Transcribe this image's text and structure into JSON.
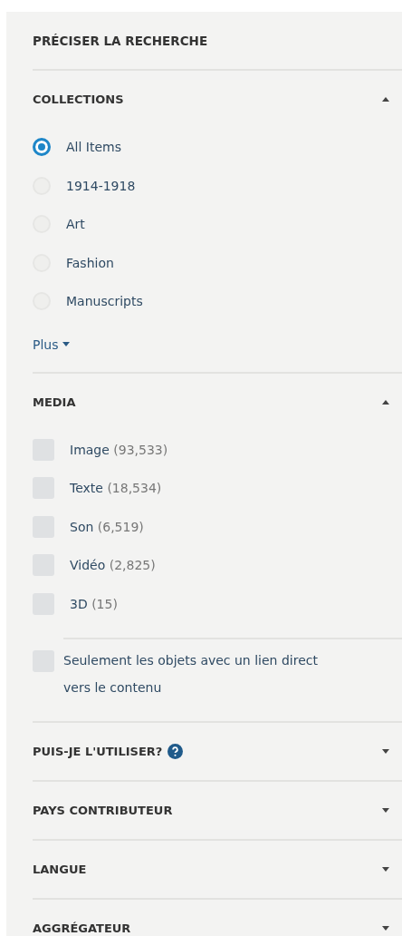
{
  "title": "PRÉCISER LA RECHERCHE",
  "sections": [
    {
      "heading": "COLLECTIONS",
      "expanded": true,
      "kind": "radio",
      "options": [
        {
          "label": "All Items",
          "selected": true
        },
        {
          "label": "1914-1918",
          "selected": false
        },
        {
          "label": "Art",
          "selected": false
        },
        {
          "label": "Fashion",
          "selected": false
        },
        {
          "label": "Manuscripts",
          "selected": false
        }
      ],
      "more": "Plus"
    },
    {
      "heading": "MEDIA",
      "expanded": true,
      "kind": "checkbox",
      "options": [
        {
          "label": "Image",
          "count": "(93,533)",
          "checked": false
        },
        {
          "label": "Texte",
          "count": "(18,534)",
          "checked": false
        },
        {
          "label": "Son",
          "count": "(6,519)",
          "checked": false
        },
        {
          "label": "Vidéo",
          "count": "(2,825)",
          "checked": false
        },
        {
          "label": "3D",
          "count": "(15)",
          "checked": false
        }
      ],
      "extra": {
        "label": "Seulement les objets avec un lien direct vers le contenu",
        "checked": false
      }
    },
    {
      "heading": "PUIS-JE L'UTILISER?",
      "expanded": false,
      "help": true
    },
    {
      "heading": "PAYS CONTRIBUTEUR",
      "expanded": false
    },
    {
      "heading": "LANGUE",
      "expanded": false
    },
    {
      "heading": "AGGRÉGATEUR",
      "expanded": false
    }
  ]
}
